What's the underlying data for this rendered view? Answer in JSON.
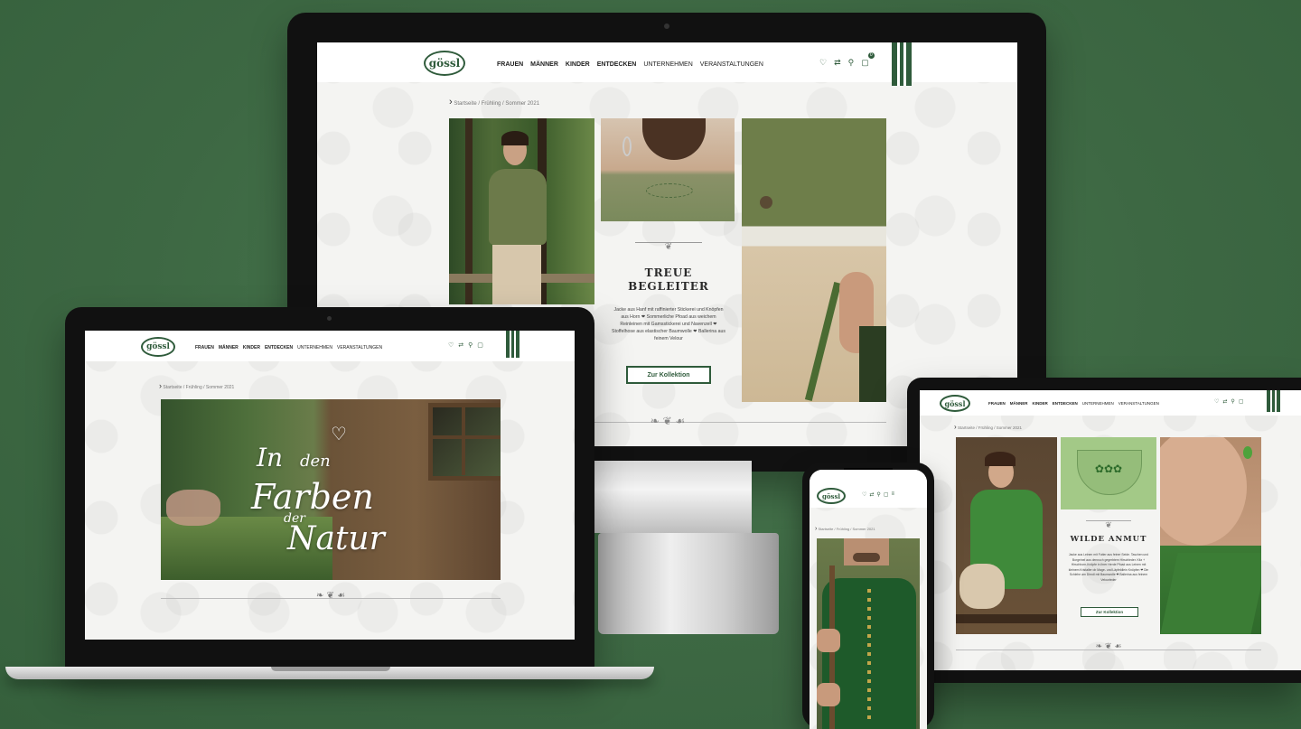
{
  "brand": {
    "logo_text": "gössl",
    "accent": "#2f5b3b",
    "background": "#3f6a45"
  },
  "nav": {
    "items": [
      "FRAUEN",
      "MÄNNER",
      "KINDER",
      "ENTDECKEN",
      "UNTERNEHMEN",
      "VERANSTALTUNGEN"
    ]
  },
  "icons": [
    "heart-icon",
    "compare-icon",
    "search-icon",
    "cart-icon"
  ],
  "cart_count": "0",
  "breadcrumb": "Startseite / Frühling / Sommer 2021",
  "monitor": {
    "product_title_line1": "TREUE",
    "product_title_line2": "BEGLEITER",
    "product_text": "Jacke aus Hanf mit raffinierter Stickerei und Knöpfen aus Horn ❤ Sommerliche Pfoad aus weichem Reinleinen mit Gamsstickerei und Navenzell ❤ Stoffelhose aus elastischer Baumwolle ❤ Ballerina aus feinem Velour",
    "cta": "Zur Kollektion"
  },
  "laptop": {
    "hero_line1": "In",
    "hero_line2": "den",
    "hero_line3": "Farben",
    "hero_line4": "der",
    "hero_line5": "Natur"
  },
  "tablet": {
    "product_title": "WILDE ANMUT",
    "product_text": "Jacke aus Leinen mit Futter aus feiner Seide. Taschen und Borgeinel aus dennoch gegerbtem Hirschleder. Kitz + Hirschhorn-Knöpfe in ihrer Herde Pfoad aus Leinen mit kleinem Kristaller ob Mage- und Läpfeldlein Knöpfen ❤ Die Schlehe am Dirndl mit Baumwolle ❤ Ballerina aus feinem Velourleder",
    "cta": "Zur Kollektion"
  }
}
